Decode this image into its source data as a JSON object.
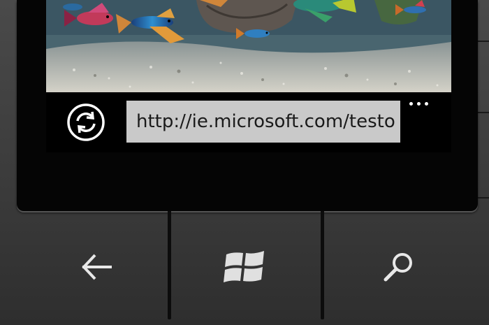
{
  "browser": {
    "address_url": "http://ie.microsoft.com/testo",
    "refresh_icon": "refresh-icon",
    "more_icon": "more-options-icon"
  },
  "webview": {
    "content": "aquarium-fish-image"
  },
  "hardware_buttons": {
    "back_icon": "back-arrow-icon",
    "start_icon": "windows-logo-icon",
    "search_icon": "search-icon"
  },
  "colors": {
    "address_bar_bg": "#c9c9c9",
    "screen_bg": "#000000",
    "phone_body": "#3a3a3a",
    "icon_color": "#e8e8e8"
  }
}
